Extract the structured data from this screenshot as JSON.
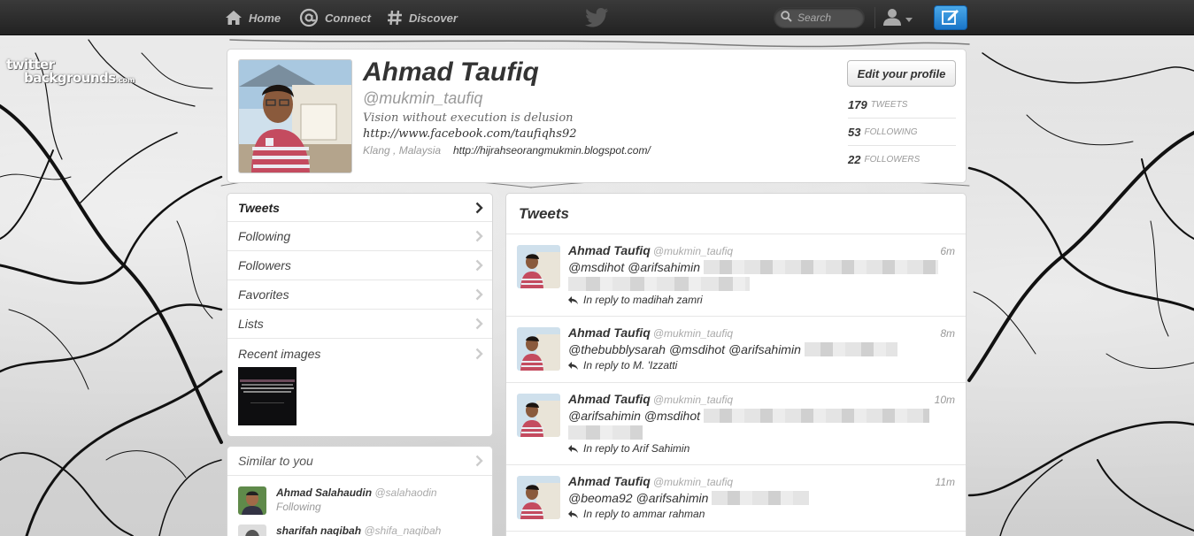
{
  "topbar": {
    "home": "Home",
    "connect": "Connect",
    "discover": "Discover",
    "search_placeholder": "Search"
  },
  "watermark": {
    "line1": "twitter",
    "line2": "backgrounds",
    "domain": ".com"
  },
  "profile": {
    "name": "Ahmad Taufiq",
    "handle": "@mukmin_taufiq",
    "bio": "Vision without execution is delusion",
    "facebook": "http://www.facebook.com/taufiqhs92",
    "location": "Klang , Malaysia",
    "url": "http://hijrahseorangmukmin.blogspot.com/",
    "edit_label": "Edit your profile",
    "stats": [
      {
        "count": "179",
        "label": "TWEETS"
      },
      {
        "count": "53",
        "label": "FOLLOWING"
      },
      {
        "count": "22",
        "label": "FOLLOWERS"
      }
    ]
  },
  "leftnav": {
    "items": [
      "Tweets",
      "Following",
      "Followers",
      "Favorites",
      "Lists",
      "Recent images"
    ]
  },
  "similar": {
    "title": "Similar to you",
    "users": [
      {
        "name": "Ahmad Salahaudin",
        "handle": "@salahaodin",
        "status": "Following"
      },
      {
        "name": "sharifah naqibah",
        "handle": "@shifa_naqibah",
        "status": ""
      }
    ]
  },
  "tweets": {
    "title": "Tweets",
    "items": [
      {
        "name": "Ahmad Taufiq",
        "handle": "@mukmin_taufiq",
        "time": "6m",
        "text": "@msdihot @arifsahimin",
        "reply": "In reply to madihah zamri"
      },
      {
        "name": "Ahmad Taufiq",
        "handle": "@mukmin_taufiq",
        "time": "8m",
        "text": "@thebubblysarah @msdihot @arifsahimin",
        "reply": "In reply to M. 'Izzatti"
      },
      {
        "name": "Ahmad Taufiq",
        "handle": "@mukmin_taufiq",
        "time": "10m",
        "text": "@arifsahimin @msdihot",
        "reply": "In reply to Arif Sahimin"
      },
      {
        "name": "Ahmad Taufiq",
        "handle": "@mukmin_taufiq",
        "time": "11m",
        "text": "@beoma92 @arifsahimin",
        "reply": "In reply to ammar rahman"
      }
    ]
  }
}
